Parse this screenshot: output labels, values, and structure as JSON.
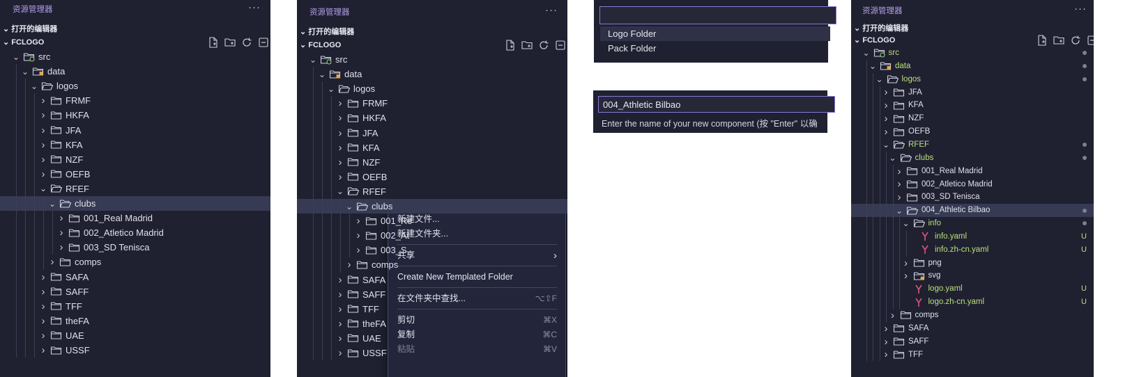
{
  "panel1": {
    "header": "资源管理器",
    "more": "···",
    "open_editors": "打开的编辑器",
    "workspace": "FCLOGO",
    "tree": [
      {
        "label": "src",
        "depth": 1,
        "open": true,
        "icon": "folder-src-icon"
      },
      {
        "label": "data",
        "depth": 2,
        "open": true,
        "icon": "folder-data-icon"
      },
      {
        "label": "logos",
        "depth": 3,
        "open": true,
        "icon": "folder-open-icon"
      },
      {
        "label": "FRMF",
        "depth": 4,
        "open": false,
        "icon": "folder-icon"
      },
      {
        "label": "HKFA",
        "depth": 4,
        "open": false,
        "icon": "folder-icon"
      },
      {
        "label": "JFA",
        "depth": 4,
        "open": false,
        "icon": "folder-icon"
      },
      {
        "label": "KFA",
        "depth": 4,
        "open": false,
        "icon": "folder-icon"
      },
      {
        "label": "NZF",
        "depth": 4,
        "open": false,
        "icon": "folder-icon"
      },
      {
        "label": "OEFB",
        "depth": 4,
        "open": false,
        "icon": "folder-icon"
      },
      {
        "label": "RFEF",
        "depth": 4,
        "open": true,
        "icon": "folder-open-icon"
      },
      {
        "label": "clubs",
        "depth": 5,
        "open": true,
        "icon": "folder-open-icon",
        "selected": true
      },
      {
        "label": "001_Real Madrid",
        "depth": 6,
        "open": false,
        "icon": "folder-icon"
      },
      {
        "label": "002_Atletico Madrid",
        "depth": 6,
        "open": false,
        "icon": "folder-icon"
      },
      {
        "label": "003_SD Tenisca",
        "depth": 6,
        "open": false,
        "icon": "folder-icon"
      },
      {
        "label": "comps",
        "depth": 5,
        "open": false,
        "icon": "folder-icon"
      },
      {
        "label": "SAFA",
        "depth": 4,
        "open": false,
        "icon": "folder-icon"
      },
      {
        "label": "SAFF",
        "depth": 4,
        "open": false,
        "icon": "folder-icon"
      },
      {
        "label": "TFF",
        "depth": 4,
        "open": false,
        "icon": "folder-icon"
      },
      {
        "label": "theFA",
        "depth": 4,
        "open": false,
        "icon": "folder-icon"
      },
      {
        "label": "UAE",
        "depth": 4,
        "open": false,
        "icon": "folder-icon"
      },
      {
        "label": "USSF",
        "depth": 4,
        "open": false,
        "icon": "folder-icon"
      }
    ]
  },
  "panel2": {
    "header": "资源管理器",
    "more": "···",
    "open_editors": "打开的编辑器",
    "workspace": "FCLOGO",
    "tree": [
      {
        "label": "src",
        "depth": 1,
        "open": true,
        "icon": "folder-src-icon"
      },
      {
        "label": "data",
        "depth": 2,
        "open": true,
        "icon": "folder-data-icon"
      },
      {
        "label": "logos",
        "depth": 3,
        "open": true,
        "icon": "folder-open-icon"
      },
      {
        "label": "FRMF",
        "depth": 4,
        "open": false,
        "icon": "folder-icon"
      },
      {
        "label": "HKFA",
        "depth": 4,
        "open": false,
        "icon": "folder-icon"
      },
      {
        "label": "JFA",
        "depth": 4,
        "open": false,
        "icon": "folder-icon"
      },
      {
        "label": "KFA",
        "depth": 4,
        "open": false,
        "icon": "folder-icon"
      },
      {
        "label": "NZF",
        "depth": 4,
        "open": false,
        "icon": "folder-icon"
      },
      {
        "label": "OEFB",
        "depth": 4,
        "open": false,
        "icon": "folder-icon"
      },
      {
        "label": "RFEF",
        "depth": 4,
        "open": true,
        "icon": "folder-open-icon"
      },
      {
        "label": "clubs",
        "depth": 5,
        "open": true,
        "icon": "folder-open-icon",
        "selected": true
      },
      {
        "label": "001_Re",
        "depth": 6,
        "open": false,
        "icon": "folder-icon"
      },
      {
        "label": "002_At",
        "depth": 6,
        "open": false,
        "icon": "folder-icon"
      },
      {
        "label": "003_S",
        "depth": 6,
        "open": false,
        "icon": "folder-icon"
      },
      {
        "label": "comps",
        "depth": 5,
        "open": false,
        "icon": "folder-icon"
      },
      {
        "label": "SAFA",
        "depth": 4,
        "open": false,
        "icon": "folder-icon"
      },
      {
        "label": "SAFF",
        "depth": 4,
        "open": false,
        "icon": "folder-icon"
      },
      {
        "label": "TFF",
        "depth": 4,
        "open": false,
        "icon": "folder-icon"
      },
      {
        "label": "theFA",
        "depth": 4,
        "open": false,
        "icon": "folder-icon"
      },
      {
        "label": "UAE",
        "depth": 4,
        "open": false,
        "icon": "folder-icon"
      },
      {
        "label": "USSF",
        "depth": 4,
        "open": false,
        "icon": "folder-icon"
      }
    ],
    "context_menu": [
      {
        "label": "新建文件...",
        "shortcut": ""
      },
      {
        "label": "新建文件夹...",
        "shortcut": ""
      },
      {
        "sep": true
      },
      {
        "label": "共享",
        "shortcut": "",
        "submenu": true
      },
      {
        "sep": true
      },
      {
        "label": "Create New Templated Folder",
        "shortcut": ""
      },
      {
        "sep": true
      },
      {
        "label": "在文件夹中查找...",
        "shortcut": "⌥⇧F"
      },
      {
        "sep": true
      },
      {
        "label": "剪切",
        "shortcut": "⌘X"
      },
      {
        "label": "复制",
        "shortcut": "⌘C"
      },
      {
        "label": "粘贴",
        "shortcut": "⌘V",
        "disabled": true
      }
    ]
  },
  "quickpick1": {
    "input_value": "",
    "options": [
      "Logo Folder",
      "Pack Folder"
    ]
  },
  "quickpick2": {
    "input_value": "004_Athletic Bilbao",
    "hint": "Enter the name of your new component (按 \"Enter\" 以确"
  },
  "panel3": {
    "header": "资源管理器",
    "more": "···",
    "open_editors": "打开的编辑器",
    "workspace": "FCLOGO",
    "tree": [
      {
        "label": "src",
        "depth": 1,
        "open": true,
        "icon": "folder-src-icon",
        "green": true,
        "dot": true
      },
      {
        "label": "data",
        "depth": 2,
        "open": true,
        "icon": "folder-data-icon",
        "green": true,
        "dot": true
      },
      {
        "label": "logos",
        "depth": 3,
        "open": true,
        "icon": "folder-open-icon",
        "green": true,
        "dot": true
      },
      {
        "label": "JFA",
        "depth": 4,
        "open": false,
        "icon": "folder-icon"
      },
      {
        "label": "KFA",
        "depth": 4,
        "open": false,
        "icon": "folder-icon"
      },
      {
        "label": "NZF",
        "depth": 4,
        "open": false,
        "icon": "folder-icon"
      },
      {
        "label": "OEFB",
        "depth": 4,
        "open": false,
        "icon": "folder-icon"
      },
      {
        "label": "RFEF",
        "depth": 4,
        "open": true,
        "icon": "folder-open-icon",
        "green": true,
        "dot": true
      },
      {
        "label": "clubs",
        "depth": 5,
        "open": true,
        "icon": "folder-open-icon",
        "green": true,
        "dot": true
      },
      {
        "label": "001_Real Madrid",
        "depth": 6,
        "open": false,
        "icon": "folder-icon"
      },
      {
        "label": "002_Atletico Madrid",
        "depth": 6,
        "open": false,
        "icon": "folder-icon"
      },
      {
        "label": "003_SD Tenisca",
        "depth": 6,
        "open": false,
        "icon": "folder-icon"
      },
      {
        "label": "004_Athletic Bilbao",
        "depth": 6,
        "open": true,
        "icon": "folder-open-icon",
        "selected": true,
        "dot": true
      },
      {
        "label": "info",
        "depth": 7,
        "open": true,
        "icon": "folder-open-icon",
        "green": true,
        "dot": true
      },
      {
        "label": "info.yaml",
        "depth": 8,
        "file": true,
        "icon": "yaml-icon",
        "green": true,
        "badge": "U"
      },
      {
        "label": "info.zh-cn.yaml",
        "depth": 8,
        "file": true,
        "icon": "yaml-icon",
        "green": true,
        "badge": "U"
      },
      {
        "label": "png",
        "depth": 7,
        "open": false,
        "icon": "folder-icon"
      },
      {
        "label": "svg",
        "depth": 7,
        "open": false,
        "icon": "folder-svg-icon"
      },
      {
        "label": "logo.yaml",
        "depth": 7,
        "file": true,
        "icon": "yaml-icon",
        "green": true,
        "badge": "U"
      },
      {
        "label": "logo.zh-cn.yaml",
        "depth": 7,
        "file": true,
        "icon": "yaml-icon",
        "green": true,
        "badge": "U"
      },
      {
        "label": "comps",
        "depth": 5,
        "open": false,
        "icon": "folder-icon"
      },
      {
        "label": "SAFA",
        "depth": 4,
        "open": false,
        "icon": "folder-icon"
      },
      {
        "label": "SAFF",
        "depth": 4,
        "open": false,
        "icon": "folder-icon"
      },
      {
        "label": "TFF",
        "depth": 4,
        "open": false,
        "icon": "folder-icon"
      }
    ]
  },
  "colors": {
    "bg": "#1f2030",
    "selected": "#363a52",
    "accent": "#b4a0e8",
    "git_untracked": "#b9e07a",
    "yaml_icon": "#e0527d"
  }
}
